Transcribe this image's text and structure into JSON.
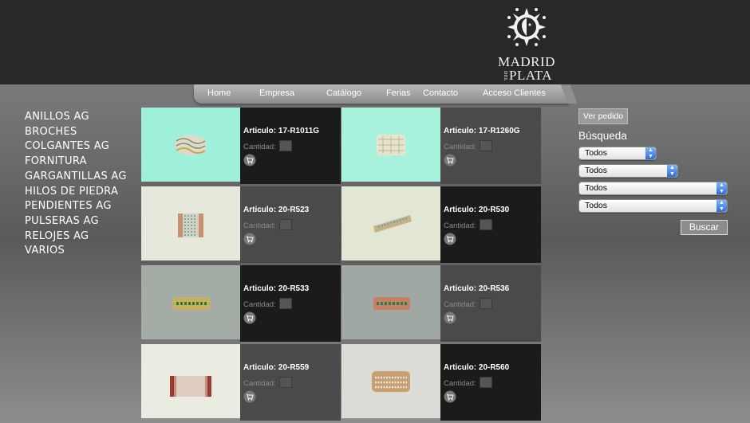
{
  "brand": {
    "line1": "MADRID",
    "del": "DEL",
    "line2": "PLATA"
  },
  "nav": [
    "Home",
    "Empresa",
    "Catálogo",
    "Ferias",
    "Contacto",
    "Acceso Clientes"
  ],
  "categories": [
    "ANILLOS AG",
    "BROCHES",
    "COLGANTES AG",
    "FORNITURA",
    "GARGANTILLAS AG",
    "HILOS DE PIEDRA",
    "PENDIENTES AG",
    "PULSERAS AG",
    "RELOJES AG",
    "VARIOS"
  ],
  "quantity_label": "Cantidad:",
  "products": [
    {
      "article": "Articulo: 17-R1011G",
      "bg": "#9ef0da"
    },
    {
      "article": "Articulo: 17-R1260G",
      "bg": "#a8f2de"
    },
    {
      "article": "Articulo: 20-R523",
      "bg": "#e6e8dc"
    },
    {
      "article": "Articulo: 20-R530",
      "bg": "#e2e6d4"
    },
    {
      "article": "Articulo: 20-R533",
      "bg": "#a4aca6"
    },
    {
      "article": "Articulo: 20-R536",
      "bg": "#a0a8a4"
    },
    {
      "article": "Articulo: 20-R559",
      "bg": "#eaece2"
    },
    {
      "article": "Articulo: 20-R560",
      "bg": "#dcdcd6"
    }
  ],
  "order_button": "Ver pedido",
  "search": {
    "title": "Búsqueda",
    "selects": [
      "Todos",
      "Todos",
      "Todos",
      "Todos"
    ],
    "button": "Buscar"
  }
}
